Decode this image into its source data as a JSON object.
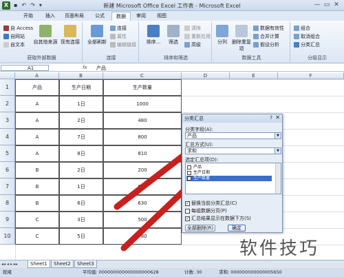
{
  "window": {
    "title": "新建 Microsoft Office Excel 工作表 - Microsoft Excel",
    "logo": "X",
    "qat": [
      "save-icon",
      "undo-icon",
      "redo-icon",
      "customize-icon"
    ],
    "controls": [
      "—",
      "▭",
      "✕"
    ]
  },
  "tabs": [
    "开始",
    "插入",
    "页面布局",
    "公式",
    "数据",
    "审阅",
    "视图"
  ],
  "active_tab": "数据",
  "ribbon": {
    "external": {
      "items": [
        "自 Access",
        "自网站",
        "自文本"
      ],
      "big": [
        "自其他来源",
        "现有连接"
      ],
      "label": "获取外部数据"
    },
    "connections": {
      "big": "全部刷新",
      "items": [
        "连接",
        "属性",
        "编辑链接"
      ],
      "label": "连接"
    },
    "sort": {
      "items": [
        "清除",
        "重新应用",
        "高级"
      ],
      "big": [
        "排序...",
        "筛选"
      ],
      "label": "排序和筛选"
    },
    "tools": {
      "big": [
        "分列",
        "删除重复项"
      ],
      "items": [
        "数据有效性",
        "合并计算",
        "假设分析"
      ],
      "label": "数据工具"
    },
    "outline": {
      "items": [
        "组合",
        "取消组合",
        "分类汇总"
      ],
      "label": "分级显示"
    }
  },
  "formula_bar": {
    "name_box": "A1",
    "fx": "fx",
    "value": "产品"
  },
  "columns": [
    "A",
    "B",
    "C",
    "D",
    "E",
    "F"
  ],
  "rows": [
    "1",
    "2",
    "3",
    "4",
    "5",
    "6",
    "7",
    "8",
    "9",
    "10"
  ],
  "table": {
    "headers": [
      "产品",
      "生产日期",
      "生产数量"
    ],
    "rows": [
      [
        "A",
        "1日",
        "1000"
      ],
      [
        "A",
        "2日",
        "480"
      ],
      [
        "A",
        "7日",
        "800"
      ],
      [
        "A",
        "8日",
        "810"
      ],
      [
        "B",
        "2日",
        "200"
      ],
      [
        "B",
        "1日",
        "650"
      ],
      [
        "B",
        "6日",
        "630"
      ],
      [
        "C",
        "3日",
        "500"
      ],
      [
        "C",
        "5日",
        "780"
      ]
    ]
  },
  "dialog": {
    "title": "分类汇总",
    "help": "?",
    "close": "✕",
    "group_by_label": "分类字段(A):",
    "group_by_value": "产品",
    "summary_label": "汇总方式(U):",
    "summary_value": "求和",
    "items_label": "选定汇总项(D):",
    "items": [
      {
        "label": "产品",
        "checked": false
      },
      {
        "label": "生产日期",
        "checked": false
      },
      {
        "label": "生产数量",
        "checked": true
      }
    ],
    "options": [
      {
        "label": "替换当前分类汇总(C)",
        "checked": true
      },
      {
        "label": "每组数据分页(P)",
        "checked": false
      },
      {
        "label": "汇总结果显示在数据下方(S)",
        "checked": true
      }
    ],
    "remove_all_label": "全部删除(R)",
    "ok_label": "确定"
  },
  "sheets": [
    "Sheet1",
    "Sheet2",
    "Sheet3"
  ],
  "active_sheet": "Sheet1",
  "status": {
    "ready": "就绪",
    "average": "平均值: 000000000000000000628",
    "count": "计数: 30",
    "sum": "求和: 000000000000005650"
  },
  "watermark": "软件技巧",
  "arrow_color": "#c8201e"
}
